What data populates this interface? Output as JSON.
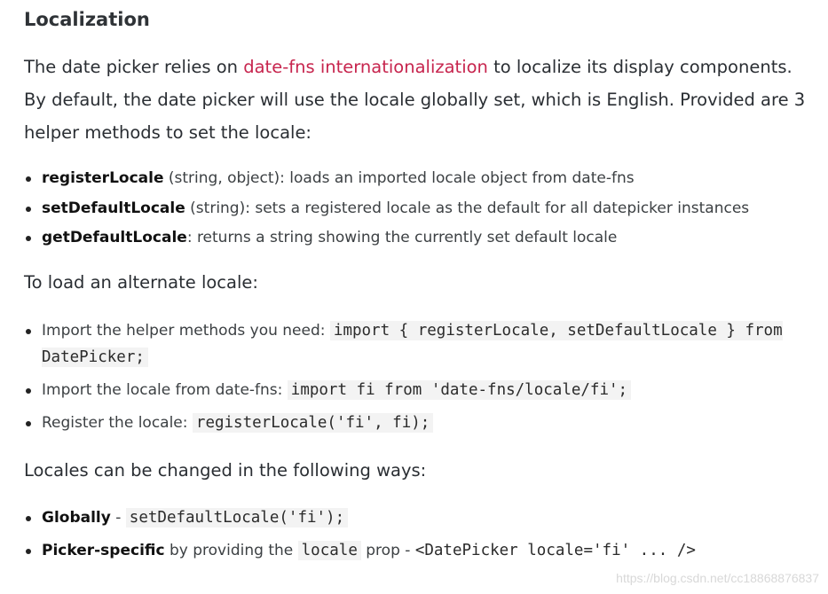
{
  "heading": "Localization",
  "intro": {
    "before_link": "The date picker relies on ",
    "link_text": "date-fns internationalization",
    "after_link": " to localize its display components. By default, the date picker will use the locale globally set, which is English. Provided are 3 helper methods to set the locale:"
  },
  "helper_methods": [
    {
      "name": "registerLocale",
      "desc": " (string, object): loads an imported locale object from date-fns"
    },
    {
      "name": "setDefaultLocale",
      "desc": " (string): sets a registered locale as the default for all datepicker instances"
    },
    {
      "name": "getDefaultLocale",
      "desc": ": returns a string showing the currently set default locale"
    }
  ],
  "load_heading": "To load an alternate locale:",
  "load_steps": [
    {
      "text": "Import the helper methods you need: ",
      "code": "import { registerLocale, setDefaultLocale } from DatePicker;"
    },
    {
      "text": "Import the locale from date-fns: ",
      "code": "import fi from 'date-fns/locale/fi';"
    },
    {
      "text": "Register the locale: ",
      "code": "registerLocale('fi', fi);"
    }
  ],
  "change_heading": "Locales can be changed in the following ways:",
  "change_ways": [
    {
      "bold": "Globally",
      "text1": " - ",
      "code": "setDefaultLocale('fi');"
    },
    {
      "bold": "Picker-specific",
      "text1": " by providing the ",
      "code": "locale",
      "text2": " prop - ",
      "code2": "<DatePicker locale='fi' ... />"
    }
  ],
  "watermark": "https://blog.csdn.net/cc18868876837"
}
